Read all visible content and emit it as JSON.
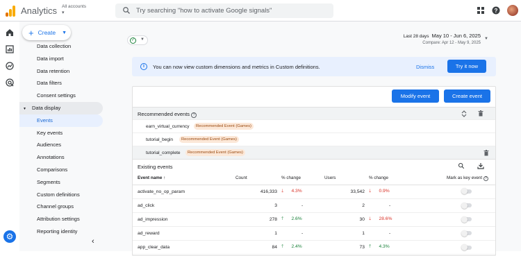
{
  "app": {
    "title": "Analytics",
    "account_label": "All accounts",
    "account_caret": "▾"
  },
  "search": {
    "placeholder": "Try searching \"how to activate Google signals\""
  },
  "create": {
    "label": "Create"
  },
  "sidebar": {
    "items": [
      {
        "label": "Data collection",
        "state": "normal"
      },
      {
        "label": "Data import",
        "state": "normal"
      },
      {
        "label": "Data retention",
        "state": "normal"
      },
      {
        "label": "Data filters",
        "state": "normal"
      },
      {
        "label": "Consent settings",
        "state": "normal"
      },
      {
        "label": "Data display",
        "state": "section"
      },
      {
        "label": "Events",
        "state": "active"
      },
      {
        "label": "Key events",
        "state": "normal"
      },
      {
        "label": "Audiences",
        "state": "normal"
      },
      {
        "label": "Annotations",
        "state": "normal"
      },
      {
        "label": "Comparisons",
        "state": "normal"
      },
      {
        "label": "Segments",
        "state": "normal"
      },
      {
        "label": "Custom definitions",
        "state": "normal"
      },
      {
        "label": "Channel groups",
        "state": "normal"
      },
      {
        "label": "Attribution settings",
        "state": "normal"
      },
      {
        "label": "Reporting identity",
        "state": "normal"
      }
    ]
  },
  "date": {
    "label": "Last 28 days",
    "range": "May 10 - Jun 6, 2025",
    "compare": "Compare: Apr 12 - May 9, 2025"
  },
  "banner": {
    "message": "You can now view custom dimensions and metrics in Custom definitions.",
    "dismiss": "Dismiss",
    "try": "Try it now"
  },
  "actions": {
    "modify": "Modify event",
    "create": "Create event"
  },
  "recommended": {
    "title": "Recommended events",
    "rows": [
      {
        "name": "earn_virtual_currency",
        "tag": "Recommended Event (Games)"
      },
      {
        "name": "tutorial_begin",
        "tag": "Recommended Event (Games)"
      },
      {
        "name": "tutorial_complete",
        "tag": "Recommended Event (Games)"
      }
    ]
  },
  "existing": {
    "title": "Existing events",
    "columns": {
      "name": "Event name",
      "sort": "↑",
      "count": "Count",
      "count_change": "% change",
      "users": "Users",
      "users_change": "% change",
      "key": "Mark as key event"
    },
    "rows": [
      {
        "name": "activate_no_op_param",
        "count": "416,333",
        "count_dir": "down",
        "count_pct": "4.3%",
        "users": "33,542",
        "users_dir": "down",
        "users_pct": "0.9%"
      },
      {
        "name": "ad_click",
        "count": "3",
        "count_dir": "none",
        "count_pct": "-",
        "users": "2",
        "users_dir": "none",
        "users_pct": "-"
      },
      {
        "name": "ad_impression",
        "count": "278",
        "count_dir": "up",
        "count_pct": "2.6%",
        "users": "30",
        "users_dir": "down",
        "users_pct": "28.6%"
      },
      {
        "name": "ad_reward",
        "count": "1",
        "count_dir": "none",
        "count_pct": "-",
        "users": "1",
        "users_dir": "none",
        "users_pct": "-"
      },
      {
        "name": "app_clear_data",
        "count": "84",
        "count_dir": "up",
        "count_pct": "2.4%",
        "users": "73",
        "users_dir": "up",
        "users_pct": "4.3%"
      }
    ]
  },
  "colors": {
    "primary": "#1a73e8",
    "up": "#188038",
    "down": "#d93025",
    "chip_bg": "#fce8d8"
  }
}
